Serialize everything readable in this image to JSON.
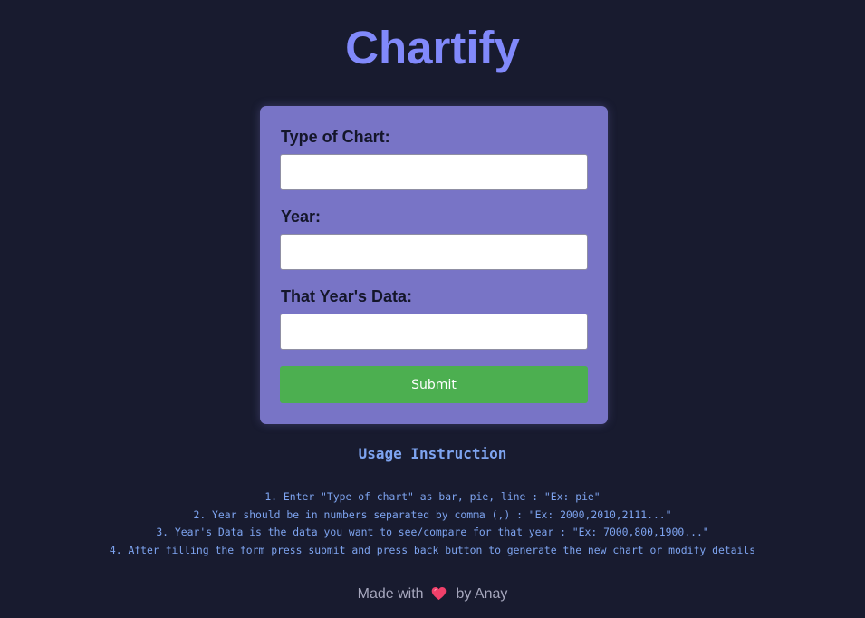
{
  "header": {
    "title": "Chartify"
  },
  "form": {
    "chart_type": {
      "label": "Type of Chart:",
      "value": "",
      "placeholder": ""
    },
    "year": {
      "label": "Year:",
      "value": "",
      "placeholder": ""
    },
    "year_data": {
      "label": "That Year's Data:",
      "value": "",
      "placeholder": ""
    },
    "submit_label": "Submit"
  },
  "usage": {
    "title": "Usage Instruction",
    "items": [
      "1. Enter \"Type of chart\" as bar, pie, line : \"Ex: pie\"",
      "2. Year should be in numbers separated by comma (,) : \"Ex: 2000,2010,2111...\"",
      "3. Year's Data is the data you want to see/compare for that year : \"Ex: 7000,800,1900...\"",
      "4. After filling the form press submit and press back button to generate the new chart or modify details"
    ]
  },
  "footer": {
    "prefix": "Made with",
    "icon": "heart-icon",
    "suffix": "by Anay"
  },
  "colors": {
    "background": "#181b2f",
    "title": "#8189fb",
    "card": "#7874c6",
    "submit": "#4caf50",
    "instructions": "#7ea4f0",
    "heart": "#f0406a"
  }
}
